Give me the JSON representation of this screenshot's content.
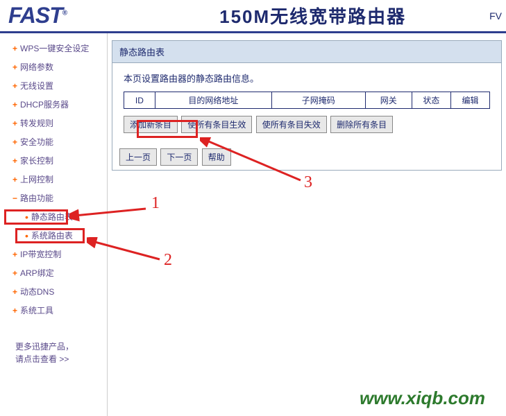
{
  "header": {
    "logo": "FAST",
    "title": "150M无线宽带路由器",
    "suffix": "FV"
  },
  "sidebar": {
    "items": [
      {
        "label": "WPS一键安全设定",
        "type": "item"
      },
      {
        "label": "网络参数",
        "type": "item"
      },
      {
        "label": "无线设置",
        "type": "item"
      },
      {
        "label": "DHCP服务器",
        "type": "item"
      },
      {
        "label": "转发规则",
        "type": "item"
      },
      {
        "label": "安全功能",
        "type": "item"
      },
      {
        "label": "家长控制",
        "type": "item"
      },
      {
        "label": "上网控制",
        "type": "item"
      },
      {
        "label": "路由功能",
        "type": "expanded"
      },
      {
        "label": "静态路由表",
        "type": "sub"
      },
      {
        "label": "系统路由表",
        "type": "sub"
      },
      {
        "label": "IP带宽控制",
        "type": "item"
      },
      {
        "label": "ARP绑定",
        "type": "item"
      },
      {
        "label": "动态DNS",
        "type": "item"
      },
      {
        "label": "系统工具",
        "type": "item"
      }
    ],
    "more": "更多迅捷产品，\n请点击查看 >>"
  },
  "panel": {
    "title": "静态路由表",
    "description": "本页设置路由器的静态路由信息。",
    "columns": [
      "ID",
      "目的网络地址",
      "子网掩码",
      "网关",
      "状态",
      "编辑"
    ],
    "buttons_row1": [
      "添加新条目",
      "使所有条目生效",
      "使所有条目失效",
      "删除所有条目"
    ],
    "buttons_row2": [
      "上一页",
      "下一页",
      "帮助"
    ]
  },
  "annotations": {
    "a1": "1",
    "a2": "2",
    "a3": "3"
  },
  "footer": "www.xiqb.com"
}
